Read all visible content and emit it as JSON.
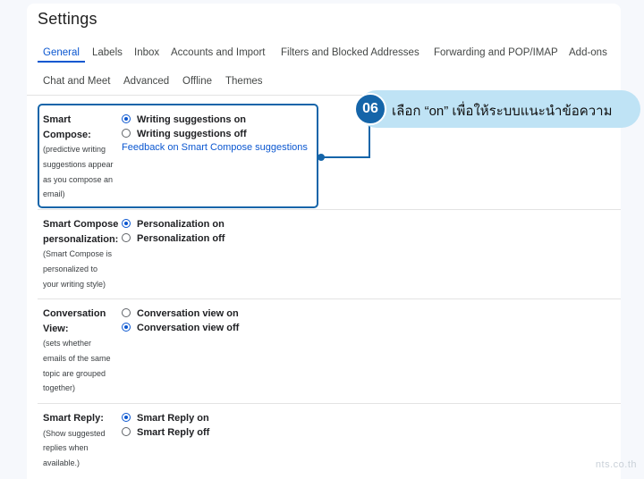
{
  "page": {
    "title": "Settings"
  },
  "tabs": [
    {
      "label": "General",
      "active": true
    },
    {
      "label": "Labels"
    },
    {
      "label": "Inbox"
    },
    {
      "label": "Accounts and Import"
    },
    {
      "label": "Filters and Blocked Addresses"
    },
    {
      "label": "Forwarding and POP/IMAP"
    },
    {
      "label": "Add-ons"
    },
    {
      "label": "Chat and Meet"
    },
    {
      "label": "Advanced"
    },
    {
      "label": "Offline"
    },
    {
      "label": "Themes"
    }
  ],
  "settings": {
    "smart_compose": {
      "label_1": "Smart",
      "label_2": "Compose:",
      "desc": [
        "(predictive writing",
        "suggestions appear",
        "as you compose an",
        "email)"
      ],
      "options": [
        "Writing suggestions on",
        "Writing suggestions off"
      ],
      "selected": "Writing suggestions on",
      "link": "Feedback on Smart Compose suggestions"
    },
    "smart_compose_personalization": {
      "label_1": "Smart Compose",
      "label_2": "personalization:",
      "desc": [
        "(Smart Compose is",
        "personalized to",
        "your writing style)"
      ],
      "options": [
        "Personalization on",
        "Personalization off"
      ],
      "selected": "Personalization on"
    },
    "conversation_view": {
      "label_1": "Conversation",
      "label_2": "View:",
      "desc": [
        "(sets whether",
        "emails of the same",
        "topic are grouped",
        "together)"
      ],
      "options": [
        "Conversation view on",
        "Conversation view off"
      ],
      "selected": "Conversation view off"
    },
    "smart_reply": {
      "label_1": "Smart Reply:",
      "desc": [
        "(Show suggested",
        "replies when",
        "available.)"
      ],
      "options": [
        "Smart Reply on",
        "Smart Reply off"
      ],
      "selected": "Smart Reply on"
    }
  },
  "callout": {
    "step": "06",
    "text": "เลือก “on” เพื่อให้ระบบแนะนำข้อความ"
  },
  "watermark": "nts.co.th",
  "colors": {
    "accent": "#0b57d0",
    "callout_bg": "#bfe3f5",
    "callout_border": "#1565a9"
  }
}
